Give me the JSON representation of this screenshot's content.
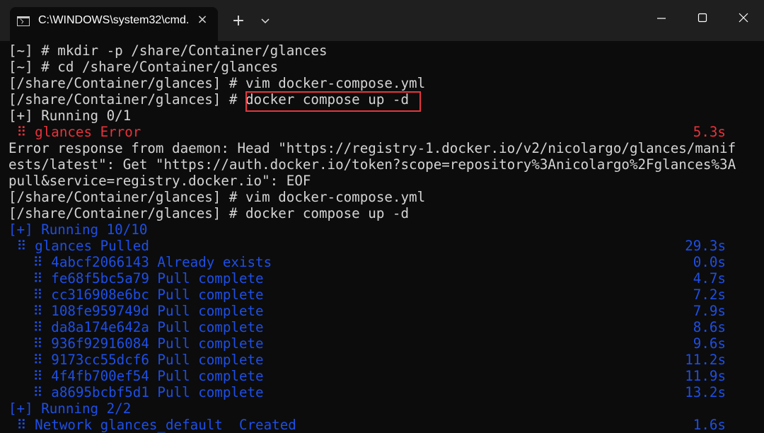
{
  "window": {
    "tab_title": "C:\\WINDOWS\\system32\\cmd.",
    "tab_close": "×",
    "new_tab": "+"
  },
  "terminal": {
    "lines": [
      "[~] # mkdir -p /share/Container/glances",
      "[~] # cd /share/Container/glances",
      "[/share/Container/glances] # vim docker-compose.yml",
      "[/share/Container/glances] # docker compose up -d",
      "[+] Running 0/1",
      " ⠿ glances Error",
      "Error response from daemon: Head \"https://registry-1.docker.io/v2/nicolargo/glances/manif",
      "ests/latest\": Get \"https://auth.docker.io/token?scope=repository%3Anicolargo%2Fglances%3A",
      "pull&service=registry.docker.io\": EOF",
      "[/share/Container/glances] # vim docker-compose.yml",
      "[/share/Container/glances] # docker compose up -d",
      "[+] Running 10/10",
      " ⠿ glances Pulled",
      "   ⠿ 4abcf2066143 Already exists",
      "   ⠿ fe68f5bc5a79 Pull complete",
      "   ⠿ cc316908e6bc Pull complete",
      "   ⠿ 108fe959749d Pull complete",
      "   ⠿ da8a174e642a Pull complete",
      "   ⠿ 936f92916084 Pull complete",
      "   ⠿ 9173cc55dcf6 Pull complete",
      "   ⠿ 4f4fb700ef54 Pull complete",
      "   ⠿ a8695bcbf5d1 Pull complete",
      "[+] Running 2/2",
      " ⠿ Network glances_default  Created"
    ],
    "durations": {
      "glances_error": "5.3s",
      "glances_pulled": "29.3s",
      "layer_1": "0.0s",
      "layer_2": "4.7s",
      "layer_3": "7.2s",
      "layer_4": "7.9s",
      "layer_5": "8.6s",
      "layer_6": "9.6s",
      "layer_7": "11.2s",
      "layer_8": "11.9s",
      "layer_9": "13.2s",
      "network": "1.6s"
    },
    "colors": {
      "normal": "#d4d4d4",
      "error": "#e8333c",
      "progress": "#1e4fe6",
      "highlight_box": "#e4373d"
    }
  }
}
